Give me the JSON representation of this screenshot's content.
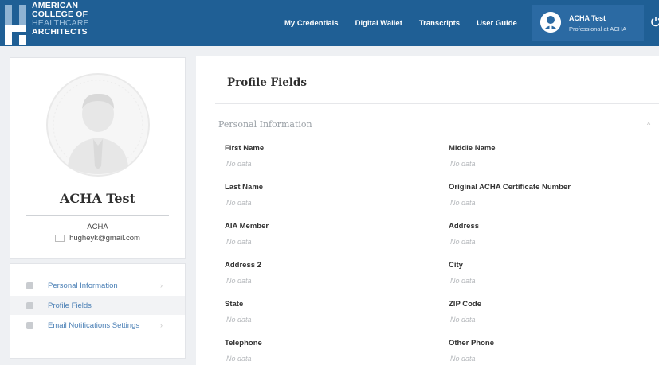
{
  "logo": {
    "line1": "AMERICAN",
    "line2": "COLLEGE OF",
    "line3": "HEALTHCARE",
    "line4": "ARCHITECTS"
  },
  "nav": {
    "items": [
      {
        "label": "My Credentials"
      },
      {
        "label": "Digital Wallet"
      },
      {
        "label": "Transcripts"
      },
      {
        "label": "User Guide"
      }
    ]
  },
  "user": {
    "name": "ACHA Test",
    "role": "Professional at ACHA"
  },
  "profile": {
    "name": "ACHA Test",
    "org": "ACHA",
    "email": "hugheyk@gmail.com"
  },
  "sidebar": {
    "items": [
      {
        "label": "Personal Information",
        "icon": "user-icon",
        "chevron": "›"
      },
      {
        "label": "Profile Fields",
        "icon": "id-card-icon",
        "active": true
      },
      {
        "label": "Email Notifications Settings",
        "icon": "bell-icon",
        "chevron": "›"
      }
    ]
  },
  "main": {
    "title": "Profile Fields",
    "section": "Personal Information",
    "collapse_glyph": "^",
    "fields": [
      {
        "label": "First Name",
        "value": "No data"
      },
      {
        "label": "Middle Name",
        "value": "No data"
      },
      {
        "label": "Last Name",
        "value": "No data"
      },
      {
        "label": "Original ACHA Certificate Number",
        "value": "No data"
      },
      {
        "label": "AIA Member",
        "value": "No data"
      },
      {
        "label": "Address",
        "value": "No data"
      },
      {
        "label": "Address 2",
        "value": "No data"
      },
      {
        "label": "City",
        "value": "No data"
      },
      {
        "label": "State",
        "value": "No data"
      },
      {
        "label": "ZIP Code",
        "value": "No data"
      },
      {
        "label": "Telephone",
        "value": "No data"
      },
      {
        "label": "Other Phone",
        "value": "No data"
      }
    ]
  },
  "colors": {
    "topbar": "#1f5f95",
    "link": "#4a7fb5",
    "user_box": "#2b6aa3"
  }
}
